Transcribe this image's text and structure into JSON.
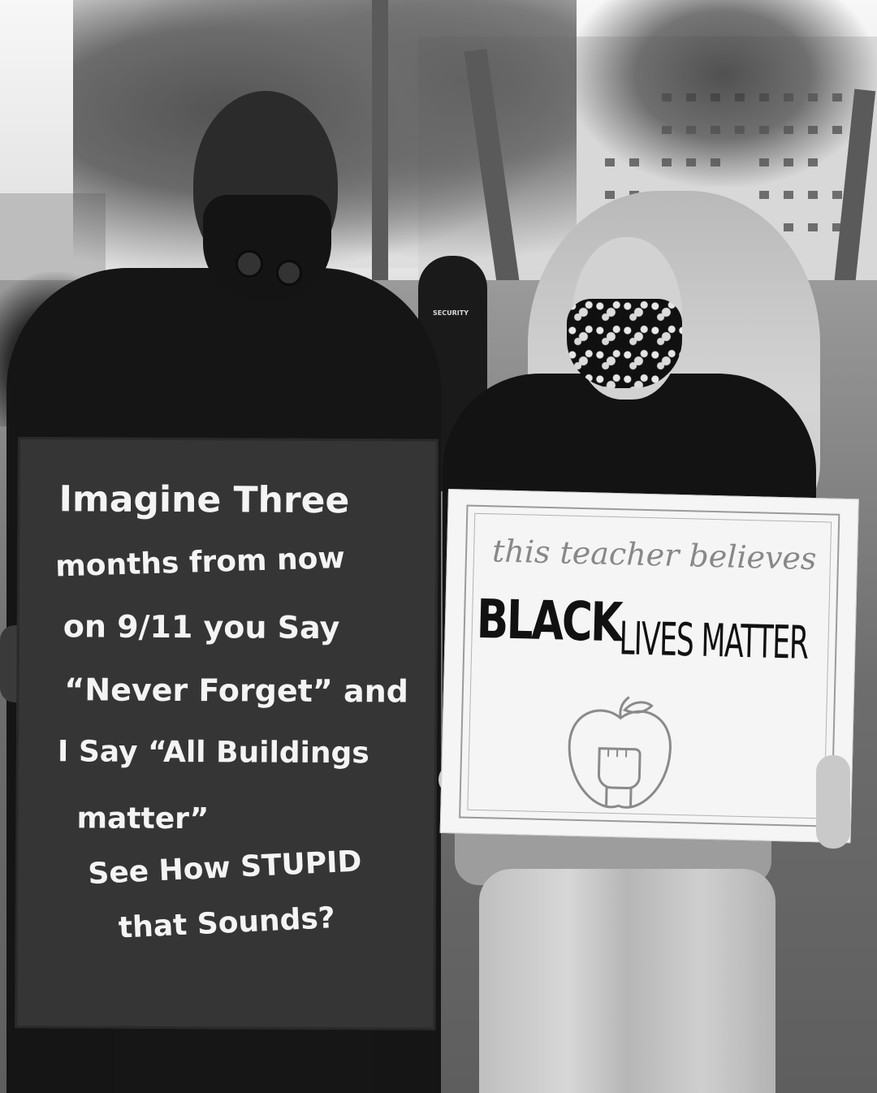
{
  "photo": {
    "style": "black-and-white",
    "guard_shirt_text": "SECURITY"
  },
  "sign_left": {
    "lines": [
      "Imagine Three",
      "months from now",
      "on 9/11 you Say",
      "“Never Forget” and",
      "I Say “All Buildings",
      "matter”",
      "See How STUPID",
      "that Sounds?"
    ]
  },
  "sign_right": {
    "script_line": "this teacher believes",
    "headline_1": "BLACK",
    "headline_2": "LIVES MATTER",
    "icon": "apple-fist-icon"
  }
}
